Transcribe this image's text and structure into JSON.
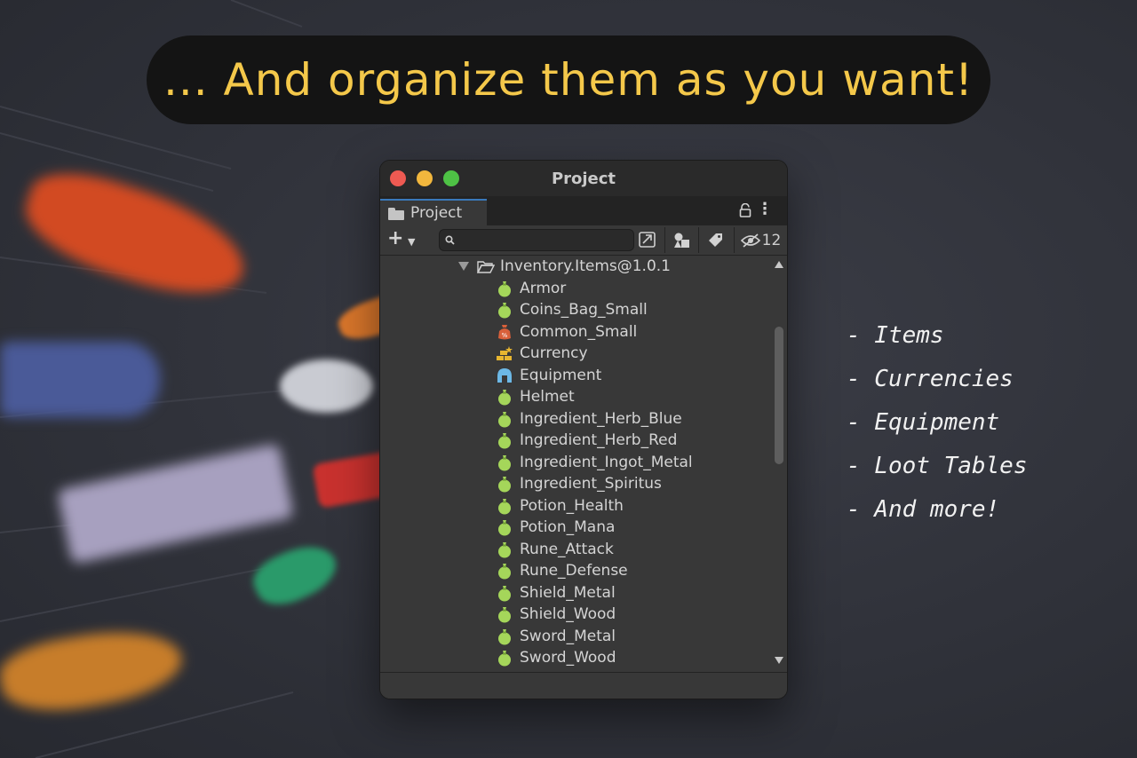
{
  "headline": "... And organize them as you want!",
  "window": {
    "title": "Project",
    "tab_label": "Project",
    "search": {
      "placeholder": "",
      "value": ""
    },
    "hidden_count": "12",
    "tree": {
      "root": "Inventory.Items@1.0.1",
      "items": [
        {
          "label": "Armor",
          "icon": "item-bag-icon"
        },
        {
          "label": "Coins_Bag_Small",
          "icon": "item-bag-icon"
        },
        {
          "label": "Common_Small",
          "icon": "loot-bag-icon"
        },
        {
          "label": "Currency",
          "icon": "gold-bars-icon"
        },
        {
          "label": "Equipment",
          "icon": "helmet-icon"
        },
        {
          "label": "Helmet",
          "icon": "item-bag-icon"
        },
        {
          "label": "Ingredient_Herb_Blue",
          "icon": "item-bag-icon"
        },
        {
          "label": "Ingredient_Herb_Red",
          "icon": "item-bag-icon"
        },
        {
          "label": "Ingredient_Ingot_Metal",
          "icon": "item-bag-icon"
        },
        {
          "label": "Ingredient_Spiritus",
          "icon": "item-bag-icon"
        },
        {
          "label": "Potion_Health",
          "icon": "item-bag-icon"
        },
        {
          "label": "Potion_Mana",
          "icon": "item-bag-icon"
        },
        {
          "label": "Rune_Attack",
          "icon": "item-bag-icon"
        },
        {
          "label": "Rune_Defense",
          "icon": "item-bag-icon"
        },
        {
          "label": "Shield_Metal",
          "icon": "item-bag-icon"
        },
        {
          "label": "Shield_Wood",
          "icon": "item-bag-icon"
        },
        {
          "label": "Sword_Metal",
          "icon": "item-bag-icon"
        },
        {
          "label": "Sword_Wood",
          "icon": "item-bag-icon"
        }
      ]
    }
  },
  "features": [
    "- Items",
    "- Currencies",
    "- Equipment",
    "- Loot Tables",
    "- And more!"
  ],
  "colors": {
    "headline": "#f4c84a",
    "item_bag": "#a5d65a",
    "loot_bag": "#d8603a",
    "gold": "#e8b630",
    "helmet": "#6cb8e6",
    "tab_accent": "#3a79bb"
  }
}
